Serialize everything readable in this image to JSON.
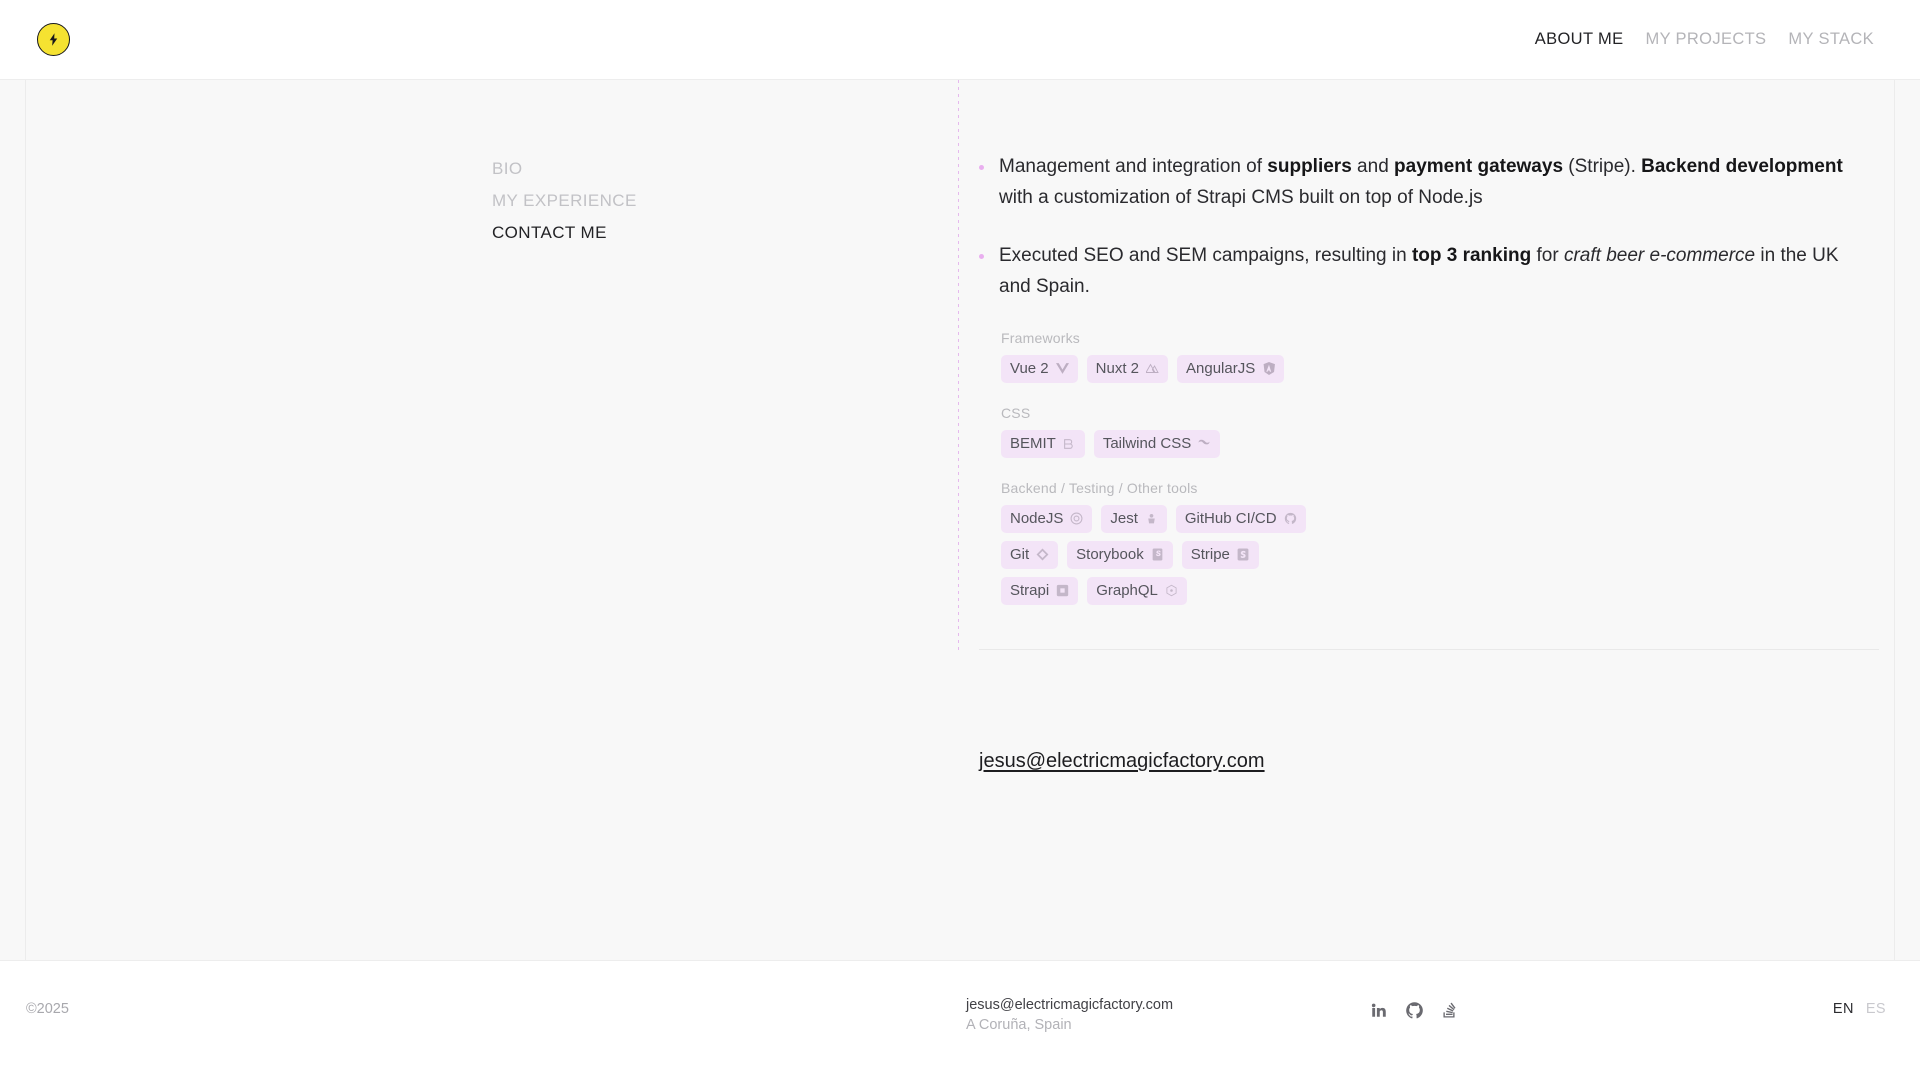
{
  "brand": {
    "logo_icon": "lightning-bolt-icon",
    "logo_color": "#f5e231"
  },
  "header": {
    "nav": [
      {
        "label": "ABOUT ME",
        "active": true
      },
      {
        "label": "MY PROJECTS",
        "active": false
      },
      {
        "label": "MY STACK",
        "active": false
      }
    ]
  },
  "sidebar": {
    "items": [
      {
        "label": "BIO",
        "active": false
      },
      {
        "label": "MY EXPERIENCE",
        "active": false
      },
      {
        "label": "CONTACT ME",
        "active": true
      }
    ]
  },
  "main": {
    "bullets": [
      {
        "parts": [
          {
            "t": "Management and integration of ",
            "s": "normal"
          },
          {
            "t": "suppliers",
            "s": "bold"
          },
          {
            "t": " and ",
            "s": "normal"
          },
          {
            "t": "payment gateways",
            "s": "bold"
          },
          {
            "t": " (Stripe). ",
            "s": "normal"
          },
          {
            "t": "Backend development",
            "s": "bold"
          },
          {
            "t": " with a customization of Strapi CMS built on top of Node.js",
            "s": "normal"
          }
        ]
      },
      {
        "parts": [
          {
            "t": "Executed SEO and SEM campaigns, resulting in ",
            "s": "normal"
          },
          {
            "t": "top 3 ranking",
            "s": "bold"
          },
          {
            "t": " for ",
            "s": "normal"
          },
          {
            "t": "craft beer e-commerce",
            "s": "italic"
          },
          {
            "t": " in the UK and Spain.",
            "s": "normal"
          }
        ]
      }
    ],
    "stack_groups": [
      {
        "label": "Frameworks",
        "tags": [
          {
            "label": "Vue 2",
            "icon": "vue-icon"
          },
          {
            "label": "Nuxt 2",
            "icon": "nuxt-icon"
          },
          {
            "label": "AngularJS",
            "icon": "angular-icon"
          }
        ]
      },
      {
        "label": "CSS",
        "tags": [
          {
            "label": "BEMIT",
            "icon": "bemit-icon"
          },
          {
            "label": "Tailwind CSS",
            "icon": "tailwind-icon"
          }
        ]
      },
      {
        "label": "Backend / Testing / Other tools",
        "tags": [
          {
            "label": "NodeJS",
            "icon": "nodejs-icon"
          },
          {
            "label": "Jest",
            "icon": "jest-icon"
          },
          {
            "label": "GitHub CI/CD",
            "icon": "github-icon"
          },
          {
            "label": "Git",
            "icon": "git-icon"
          },
          {
            "label": "Storybook",
            "icon": "storybook-icon"
          },
          {
            "label": "Stripe",
            "icon": "stripe-icon"
          },
          {
            "label": "Strapi",
            "icon": "strapi-icon"
          },
          {
            "label": "GraphQL",
            "icon": "graphql-icon"
          }
        ]
      }
    ],
    "email": "jesus@electricmagicfactory.com"
  },
  "footer": {
    "copyright": "©2025",
    "email": "jesus@electricmagicfactory.com",
    "location": "A Coruña, Spain",
    "socials": [
      {
        "name": "linkedin-icon"
      },
      {
        "name": "github-icon"
      },
      {
        "name": "stackoverflow-icon"
      }
    ],
    "languages": [
      {
        "label": "EN",
        "active": true
      },
      {
        "label": "ES",
        "active": false
      }
    ]
  },
  "colors": {
    "accent": "#e6b9ee",
    "tag_bg": "#f3e4f7",
    "body_bg": "#f8f8f8"
  }
}
